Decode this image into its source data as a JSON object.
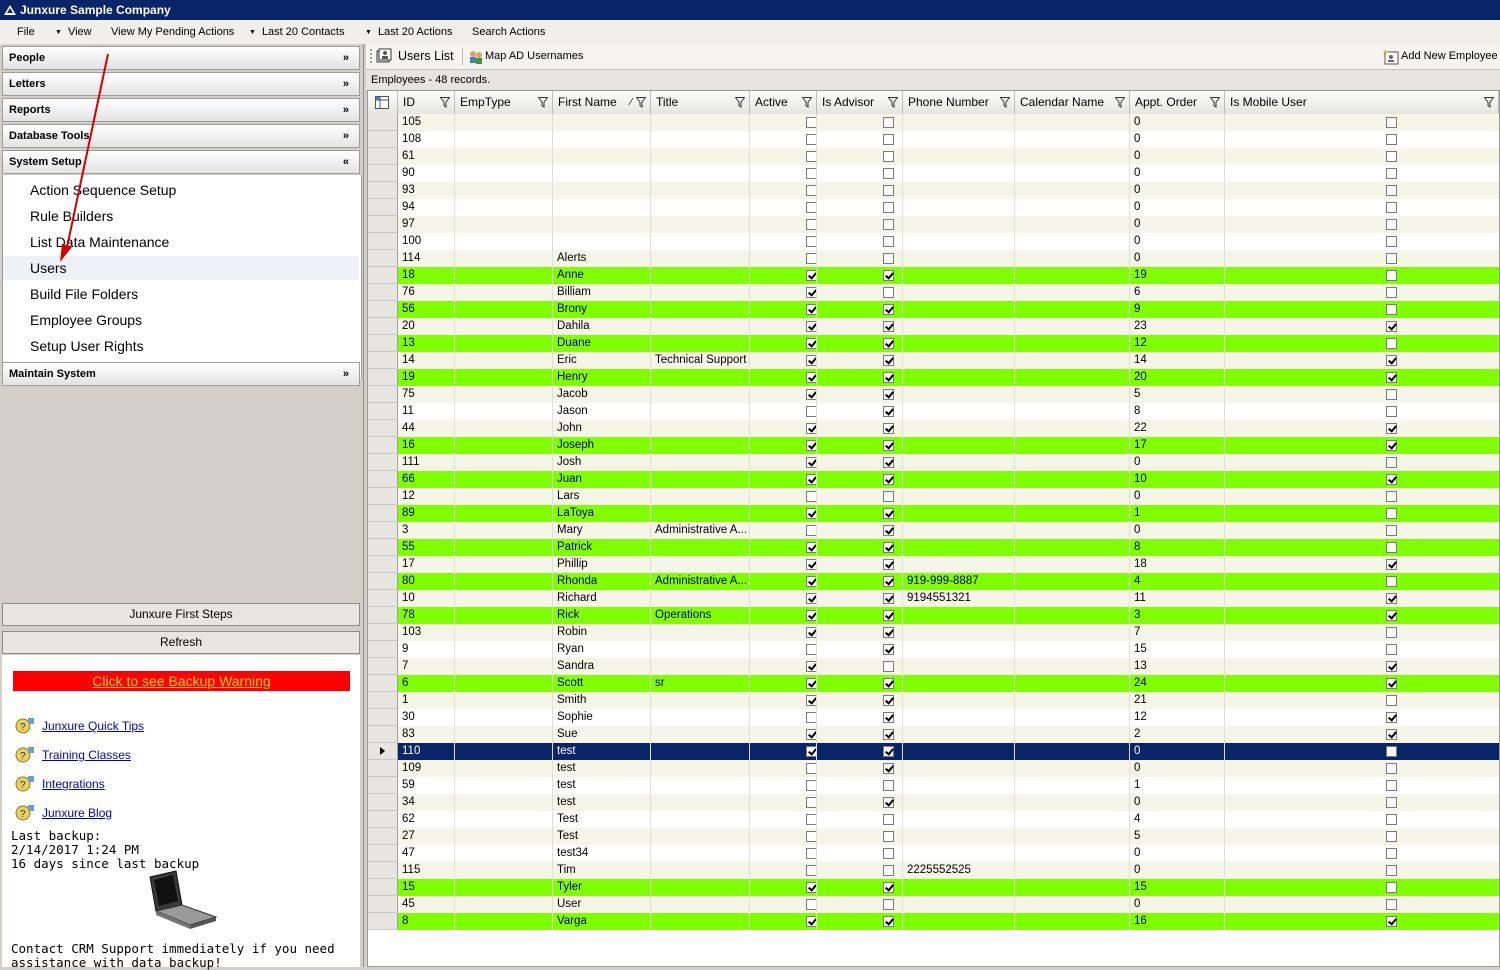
{
  "window": {
    "title": "Junxure Sample Company"
  },
  "menu": {
    "items": [
      "File",
      "View",
      "View My Pending Actions",
      "Last 20 Contacts",
      "Last 20 Actions",
      "Search Actions"
    ]
  },
  "nav": {
    "sections": [
      "People",
      "Letters",
      "Reports",
      "Database Tools",
      "System Setup",
      "Maintain System"
    ],
    "system_setup_items": [
      "Action Sequence Setup",
      "Rule Builders",
      "List Data Maintenance",
      "Users",
      "Build File Folders",
      "Employee Groups",
      "Setup User Rights"
    ],
    "selected_item": "Users"
  },
  "left_buttons": {
    "first_steps": "Junxure First Steps",
    "refresh": "Refresh"
  },
  "backup": {
    "warning_link": "Click to see Backup Warning",
    "last_backup_label": "Last backup:",
    "last_backup_date": "2/14/2017 1:24 PM",
    "days_since": "16 days since last backup",
    "contact": "Contact CRM Support immediately if you need",
    "contact2": "assistance with data backup!"
  },
  "links": [
    "Junxure Quick Tips",
    "Training Classes",
    "Integrations",
    "Junxure Blog"
  ],
  "toolbar": {
    "users_list": "Users List",
    "map_ad": "Map AD Usernames",
    "add_employee": "Add New Employee"
  },
  "record_count": "Employees - 48 records.",
  "colors": {
    "highlight": "#80ff00",
    "selected": "#0a246a",
    "title_bar": "#0a246a",
    "warning": "#ff0000"
  },
  "grid": {
    "columns": [
      "ID",
      "EmpType",
      "First Name",
      "Title",
      "Active",
      "Is Advisor",
      "Phone Number",
      "Calendar Name",
      "Appt. Order",
      "Is Mobile User"
    ],
    "sort_column": "First Name",
    "rows": [
      {
        "id": "105",
        "first": "",
        "title": "",
        "active": false,
        "advisor": false,
        "phone": "",
        "appt": "0",
        "mobile": false,
        "green": false
      },
      {
        "id": "108",
        "first": "",
        "title": "",
        "active": false,
        "advisor": false,
        "phone": "",
        "appt": "0",
        "mobile": false,
        "green": false
      },
      {
        "id": "61",
        "first": "",
        "title": "",
        "active": false,
        "advisor": false,
        "phone": "",
        "appt": "0",
        "mobile": false,
        "green": false
      },
      {
        "id": "90",
        "first": "",
        "title": "",
        "active": false,
        "advisor": false,
        "phone": "",
        "appt": "0",
        "mobile": false,
        "green": false
      },
      {
        "id": "93",
        "first": "",
        "title": "",
        "active": false,
        "advisor": false,
        "phone": "",
        "appt": "0",
        "mobile": false,
        "green": false
      },
      {
        "id": "94",
        "first": "",
        "title": "",
        "active": false,
        "advisor": false,
        "phone": "",
        "appt": "0",
        "mobile": false,
        "green": false
      },
      {
        "id": "97",
        "first": "",
        "title": "",
        "active": false,
        "advisor": false,
        "phone": "",
        "appt": "0",
        "mobile": false,
        "green": false
      },
      {
        "id": "100",
        "first": "",
        "title": "",
        "active": false,
        "advisor": false,
        "phone": "",
        "appt": "0",
        "mobile": false,
        "green": false
      },
      {
        "id": "114",
        "first": "Alerts",
        "title": "",
        "active": false,
        "advisor": false,
        "phone": "",
        "appt": "0",
        "mobile": false,
        "green": false
      },
      {
        "id": "18",
        "first": "Anne",
        "title": "",
        "active": true,
        "advisor": true,
        "phone": "",
        "appt": "19",
        "mobile": false,
        "green": true
      },
      {
        "id": "76",
        "first": "Billiam",
        "title": "",
        "active": true,
        "advisor": false,
        "phone": "",
        "appt": "6",
        "mobile": false,
        "green": false
      },
      {
        "id": "56",
        "first": "Brony",
        "title": "",
        "active": true,
        "advisor": true,
        "phone": "",
        "appt": "9",
        "mobile": false,
        "green": true
      },
      {
        "id": "20",
        "first": "Dahila",
        "title": "",
        "active": true,
        "advisor": true,
        "phone": "",
        "appt": "23",
        "mobile": true,
        "green": false
      },
      {
        "id": "13",
        "first": "Duane",
        "title": "",
        "active": true,
        "advisor": true,
        "phone": "",
        "appt": "12",
        "mobile": false,
        "green": true
      },
      {
        "id": "14",
        "first": "Eric",
        "title": "Technical Support",
        "active": true,
        "advisor": true,
        "phone": "",
        "appt": "14",
        "mobile": true,
        "green": false
      },
      {
        "id": "19",
        "first": "Henry",
        "title": "",
        "active": true,
        "advisor": true,
        "phone": "",
        "appt": "20",
        "mobile": true,
        "green": true
      },
      {
        "id": "75",
        "first": "Jacob",
        "title": "",
        "active": true,
        "advisor": true,
        "phone": "",
        "appt": "5",
        "mobile": false,
        "green": false
      },
      {
        "id": "11",
        "first": "Jason",
        "title": "",
        "active": false,
        "advisor": true,
        "phone": "",
        "appt": "8",
        "mobile": false,
        "green": false
      },
      {
        "id": "44",
        "first": "John",
        "title": "",
        "active": true,
        "advisor": true,
        "phone": "",
        "appt": "22",
        "mobile": true,
        "green": false
      },
      {
        "id": "16",
        "first": "Joseph",
        "title": "",
        "active": true,
        "advisor": true,
        "phone": "",
        "appt": "17",
        "mobile": true,
        "green": true
      },
      {
        "id": "111",
        "first": "Josh",
        "title": "",
        "active": true,
        "advisor": true,
        "phone": "",
        "appt": "0",
        "mobile": false,
        "green": false
      },
      {
        "id": "66",
        "first": "Juan",
        "title": "",
        "active": true,
        "advisor": true,
        "phone": "",
        "appt": "10",
        "mobile": true,
        "green": true
      },
      {
        "id": "12",
        "first": "Lars",
        "title": "",
        "active": false,
        "advisor": false,
        "phone": "",
        "appt": "0",
        "mobile": false,
        "green": false
      },
      {
        "id": "89",
        "first": "LaToya",
        "title": "",
        "active": true,
        "advisor": true,
        "phone": "",
        "appt": "1",
        "mobile": false,
        "green": true
      },
      {
        "id": "3",
        "first": "Mary",
        "title": "Administrative A...",
        "active": false,
        "advisor": true,
        "phone": "",
        "appt": "0",
        "mobile": false,
        "green": false
      },
      {
        "id": "55",
        "first": "Patrick",
        "title": "",
        "active": true,
        "advisor": true,
        "phone": "",
        "appt": "8",
        "mobile": false,
        "green": true
      },
      {
        "id": "17",
        "first": "Phillip",
        "title": "",
        "active": true,
        "advisor": true,
        "phone": "",
        "appt": "18",
        "mobile": true,
        "green": false
      },
      {
        "id": "80",
        "first": "Rhonda",
        "title": "Administrative A...",
        "active": true,
        "advisor": true,
        "phone": "919-999-8887",
        "appt": "4",
        "mobile": false,
        "green": true
      },
      {
        "id": "10",
        "first": "Richard",
        "title": "",
        "active": true,
        "advisor": true,
        "phone": "9194551321",
        "appt": "11",
        "mobile": true,
        "green": false
      },
      {
        "id": "78",
        "first": "Rick",
        "title": "Operations",
        "active": true,
        "advisor": true,
        "phone": "",
        "appt": "3",
        "mobile": true,
        "green": true
      },
      {
        "id": "103",
        "first": "Robin",
        "title": "",
        "active": true,
        "advisor": true,
        "phone": "",
        "appt": "7",
        "mobile": false,
        "green": false
      },
      {
        "id": "9",
        "first": "Ryan",
        "title": "",
        "active": false,
        "advisor": true,
        "phone": "",
        "appt": "15",
        "mobile": false,
        "green": false
      },
      {
        "id": "7",
        "first": "Sandra",
        "title": "",
        "active": true,
        "advisor": false,
        "phone": "",
        "appt": "13",
        "mobile": true,
        "green": false
      },
      {
        "id": "6",
        "first": "Scott",
        "title": "sr",
        "active": true,
        "advisor": true,
        "phone": "",
        "appt": "24",
        "mobile": true,
        "green": true
      },
      {
        "id": "1",
        "first": "Smith",
        "title": "",
        "active": true,
        "advisor": true,
        "phone": "",
        "appt": "21",
        "mobile": false,
        "green": false
      },
      {
        "id": "30",
        "first": "Sophie",
        "title": "",
        "active": false,
        "advisor": true,
        "phone": "",
        "appt": "12",
        "mobile": true,
        "green": false
      },
      {
        "id": "83",
        "first": "Sue",
        "title": "",
        "active": true,
        "advisor": true,
        "phone": "",
        "appt": "2",
        "mobile": true,
        "green": false
      },
      {
        "id": "110",
        "first": "test",
        "title": "",
        "active": true,
        "advisor": true,
        "phone": "",
        "appt": "0",
        "mobile": false,
        "green": false,
        "selected": true
      },
      {
        "id": "109",
        "first": "test",
        "title": "",
        "active": false,
        "advisor": true,
        "phone": "",
        "appt": "0",
        "mobile": false,
        "green": false
      },
      {
        "id": "59",
        "first": "test",
        "title": "",
        "active": false,
        "advisor": false,
        "phone": "",
        "appt": "1",
        "mobile": false,
        "green": false
      },
      {
        "id": "34",
        "first": "test",
        "title": "",
        "active": false,
        "advisor": true,
        "phone": "",
        "appt": "0",
        "mobile": false,
        "green": false
      },
      {
        "id": "62",
        "first": "Test",
        "title": "",
        "active": false,
        "advisor": false,
        "phone": "",
        "appt": "4",
        "mobile": false,
        "green": false
      },
      {
        "id": "27",
        "first": "Test",
        "title": "",
        "active": false,
        "advisor": false,
        "phone": "",
        "appt": "5",
        "mobile": false,
        "green": false
      },
      {
        "id": "47",
        "first": "test34",
        "title": "",
        "active": false,
        "advisor": false,
        "phone": "",
        "appt": "0",
        "mobile": false,
        "green": false
      },
      {
        "id": "115",
        "first": "Tim",
        "title": "",
        "active": false,
        "advisor": false,
        "phone": "2225552525",
        "appt": "0",
        "mobile": false,
        "green": false
      },
      {
        "id": "15",
        "first": "Tyler",
        "title": "",
        "active": true,
        "advisor": true,
        "phone": "",
        "appt": "15",
        "mobile": false,
        "green": true
      },
      {
        "id": "45",
        "first": "User",
        "title": "",
        "active": false,
        "advisor": false,
        "phone": "",
        "appt": "0",
        "mobile": false,
        "green": false
      },
      {
        "id": "8",
        "first": "Varga",
        "title": "",
        "active": true,
        "advisor": true,
        "phone": "",
        "appt": "16",
        "mobile": true,
        "green": true
      }
    ]
  }
}
